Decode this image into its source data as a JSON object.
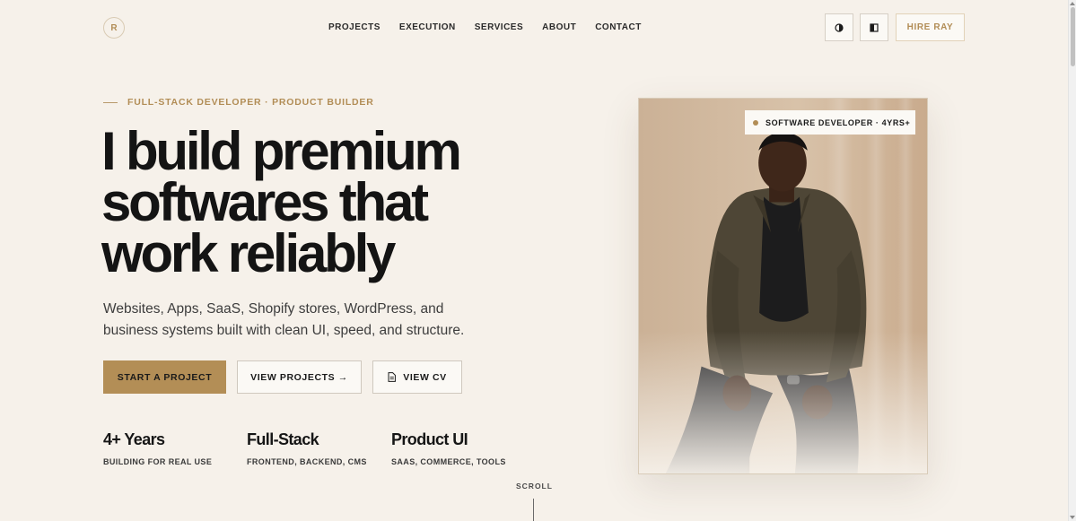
{
  "brand": {
    "logo_letter": "R"
  },
  "nav": {
    "items": [
      {
        "label": "PROJECTS"
      },
      {
        "label": "EXECUTION"
      },
      {
        "label": "SERVICES"
      },
      {
        "label": "ABOUT"
      },
      {
        "label": "CONTACT"
      }
    ]
  },
  "header_actions": {
    "theme_toggle_icon": "contrast-icon",
    "layout_toggle_icon": "half-square-icon",
    "hire_label": "HIRE RAY"
  },
  "hero": {
    "eyebrow": "FULL-STACK DEVELOPER · PRODUCT BUILDER",
    "headline_lines": [
      "I build premium",
      "softwares that",
      "work reliably"
    ],
    "subtitle": "Websites, Apps, SaaS, Shopify stores, WordPress, and business systems built with clean UI, speed, and structure.",
    "cta": {
      "primary": "START A PROJECT",
      "projects": "VIEW PROJECTS →",
      "cv": "VIEW CV",
      "cv_icon": "document-icon"
    },
    "stats": [
      {
        "value": "4+ Years",
        "label": "BUILDING FOR REAL USE"
      },
      {
        "value": "Full-Stack",
        "label": "FRONTEND, BACKEND, CMS"
      },
      {
        "value": "Product UI",
        "label": "SAAS, COMMERCE, TOOLS"
      }
    ],
    "scroll_label": "SCROLL"
  },
  "portrait": {
    "badge": "SOFTWARE DEVELOPER · 4YRS+"
  },
  "colors": {
    "background": "#f6f1ea",
    "accent": "#b38e56",
    "text": "#141414"
  }
}
